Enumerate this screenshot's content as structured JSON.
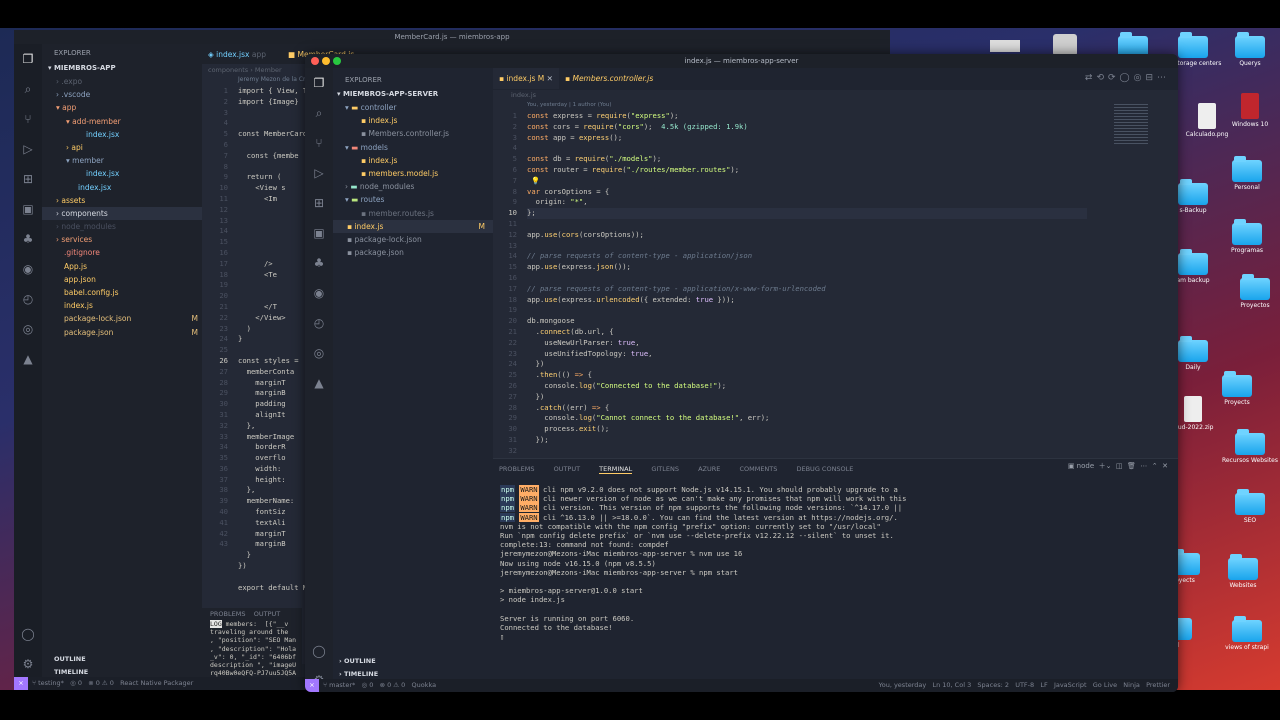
{
  "desktop": {
    "icons": [
      {
        "label": "ita storage centers"
      },
      {
        "label": "Querys"
      },
      {
        "label": "Windows 10"
      },
      {
        "label": "Calculado.png"
      },
      {
        "label": "Personal"
      },
      {
        "label": "s-Backup"
      },
      {
        "label": "Programas"
      },
      {
        "label": "am backup"
      },
      {
        "label": "Proyectos"
      },
      {
        "label": "Daily"
      },
      {
        "label": "Proyects"
      },
      {
        "label": "alud-2022.zip"
      },
      {
        "label": "Recursos Websites"
      },
      {
        "label": "SEO"
      },
      {
        "label": "oyects"
      },
      {
        "label": "Websites"
      },
      {
        "label": "views of strapi"
      },
      {
        "label": "d"
      }
    ]
  },
  "back": {
    "title": "MemberCard.js — miembros-app",
    "tab1": "index.jsx",
    "tab1_tag": "app",
    "tab2": "MemberCard.js",
    "explorer_label": "EXPLORER",
    "project": "MIEMBROS-APP",
    "breadcrumb": "components",
    "breadcrumb2": "Member",
    "blame": "Jeremy Mezon de la Cr",
    "tree": [
      ".expo",
      ".vscode",
      "app",
      "add-member",
      "index.jsx",
      "api",
      "member",
      "index.jsx",
      "index.jsx",
      "assets",
      "components",
      "node_modules",
      "services",
      ".gitignore",
      "App.js",
      "app.json",
      "babel.config.js",
      "index.js",
      "package-lock.json",
      "package.json"
    ],
    "badges": {
      "plj": "M",
      "pj": "M"
    },
    "code": [
      "import { View, T",
      "import {Image}",
      "",
      "",
      "const MemberCard",
      "",
      "  const {membe",
      "",
      "  return (",
      "    <View s",
      "      <Im",
      "",
      "",
      "",
      "",
      "",
      "      />",
      "      <Te",
      "",
      "",
      "      </T",
      "    </View>",
      "  )",
      "}",
      "",
      "const styles = ",
      "  memberConta",
      "    marginT",
      "    marginB",
      "    padding",
      "    alignIt",
      "  },",
      "  memberImage",
      "    borderR",
      "    overflo",
      "    width:",
      "    height:",
      "  },",
      "  memberName:",
      "    fontSiz",
      "    textAli",
      "    marginT",
      "    marginB",
      "  }",
      "})",
      "",
      "export default M"
    ],
    "line_nums": [
      "1",
      "2",
      "3",
      "4",
      "5",
      "6",
      "7",
      "8",
      "9",
      "10",
      "11",
      "12",
      "13",
      "14",
      "15",
      "16",
      "17",
      "18",
      "19",
      "20",
      "21",
      "22",
      "23",
      "24",
      "25",
      "26",
      "27",
      "28",
      "29",
      "30",
      "31",
      "32",
      "33",
      "34",
      "35",
      "36",
      "37",
      "38",
      "39",
      "40",
      "41",
      "42",
      "43"
    ],
    "panel_tabs": [
      "PROBLEMS",
      "OUTPUT"
    ],
    "log_label": "LOG",
    "log_lines": [
      "members:  [{\"__v",
      "traveling around the",
      ", \"position\": \"SEO Man",
      ", \"description\": \"Hola",
      "_v\": 0, \"_id\": \"6406bf",
      "description \", \"imageU",
      "rq40Bw0eQFQ-PJ7uu5JQ5A"
    ],
    "outline": "OUTLINE",
    "timeline": "TIMELINE",
    "status": {
      "branch": "testing*",
      "errors": "⊗ 0 ⚠ 0",
      "sync": "◎ 0",
      "packager": "React Native Packager"
    }
  },
  "front": {
    "title": "index.js — miembros-app-server",
    "explorer_label": "EXPLORER",
    "project": "MIEMBROS-APP-SERVER",
    "tabs": [
      {
        "label": "index.js",
        "tag": "M"
      },
      {
        "label": "Members.controller.js"
      }
    ],
    "breadcrumb": "index.js",
    "blame": "You, yesterday | 1 author (You)",
    "tree": [
      "controller",
      "index.js",
      "Members.controller.js",
      "models",
      "index.js",
      "members.model.js",
      "node_modules",
      "routes",
      "member.routes.js",
      "index.js",
      "package-lock.json",
      "package.json"
    ],
    "tree_badge": "M",
    "line_nums": [
      "1",
      "2",
      "3",
      "4",
      "5",
      "6",
      "7",
      "8",
      "9",
      "10",
      "11",
      "12",
      "13",
      "14",
      "15",
      "16",
      "17",
      "18",
      "19",
      "20",
      "21",
      "22",
      "23",
      "24",
      "25",
      "26",
      "27",
      "28",
      "29",
      "30",
      "31",
      "32"
    ],
    "code_note": "4.5k (gzipped: 1.9k)",
    "panel_tabs": [
      "PROBLEMS",
      "OUTPUT",
      "TERMINAL",
      "GITLENS",
      "AZURE",
      "COMMENTS",
      "DEBUG CONSOLE"
    ],
    "panel_active": "TERMINAL",
    "terminal_shell": "node",
    "terminal": [
      {
        "p": "npm",
        "w": "WARN",
        "t": "cli npm v9.2.0 does not support Node.js v14.15.1. You should probably upgrade to a"
      },
      {
        "p": "npm",
        "w": "WARN",
        "t": "cli newer version of node as we can't make any promises that npm will work with this"
      },
      {
        "p": "npm",
        "w": "WARN",
        "t": "cli version. This version of npm supports the following node versions: `^14.17.0 ||"
      },
      {
        "p": "npm",
        "w": "WARN",
        "t": "cli ^16.13.0 || >=18.0.0`. You can find the latest version at https://nodejs.org/."
      },
      {
        "p": "",
        "w": "",
        "t": "nvm is not compatible with the npm config \"prefix\" option: currently set to \"/usr/local\""
      },
      {
        "p": "",
        "w": "",
        "t": "Run `npm config delete prefix` or `nvm use --delete-prefix v12.22.12 --silent` to unset it."
      },
      {
        "p": "",
        "w": "",
        "t": "complete:13: command not found: compdef"
      },
      {
        "p": "",
        "w": "",
        "t": "jeremymezon@Mezons-iMac miembros-app-server % nvm use 16"
      },
      {
        "p": "",
        "w": "",
        "t": "Now using node v16.15.0 (npm v8.5.5)"
      },
      {
        "p": "",
        "w": "",
        "t": "jeremymezon@Mezons-iMac miembros-app-server % npm start"
      },
      {
        "p": "",
        "w": "",
        "t": ""
      },
      {
        "p": "",
        "w": "",
        "t": "> miembros-app-server@1.0.0 start"
      },
      {
        "p": "",
        "w": "",
        "t": "> node index.js"
      },
      {
        "p": "",
        "w": "",
        "t": ""
      },
      {
        "p": "",
        "w": "",
        "t": "Server is running on port 6060."
      },
      {
        "p": "",
        "w": "",
        "t": "Connected to the database!"
      }
    ],
    "outline": "OUTLINE",
    "timeline": "TIMELINE",
    "status": {
      "branch": "master*",
      "errors": "⊗ 0 ⚠ 0",
      "sync": "◎ 0",
      "quokka": "Quokka",
      "blame": "You, yesterday",
      "pos": "Ln 10, Col 3",
      "spaces": "Spaces: 2",
      "enc": "UTF-8",
      "eol": "LF",
      "lang": "JavaScript",
      "golive": "Go Live",
      "ninja": "Ninja",
      "prettier": "Prettier"
    }
  }
}
